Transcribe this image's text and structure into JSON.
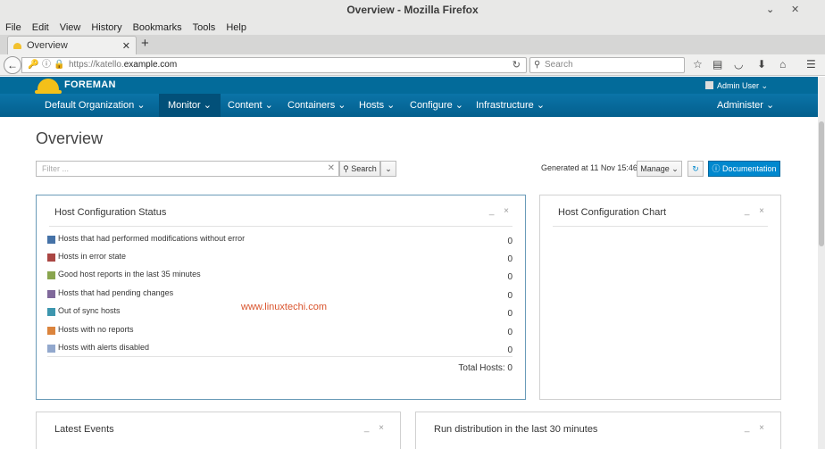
{
  "window": {
    "title": "Overview - Mozilla Firefox",
    "controls": [
      "⌄",
      "✕"
    ]
  },
  "menu": [
    "File",
    "Edit",
    "View",
    "History",
    "Bookmarks",
    "Tools",
    "Help"
  ],
  "tab": {
    "title": "Overview",
    "close": "✕",
    "new_tab": "+"
  },
  "nav": {
    "url_scheme": "https://katello.",
    "url_host": "example.com",
    "search_placeholder": "Search"
  },
  "foreman": {
    "brand": "FOREMAN",
    "user": "Admin User ⌄",
    "nav": {
      "org": "Default Organization ⌄",
      "monitor": "Monitor ⌄",
      "content": "Content ⌄",
      "containers": "Containers ⌄",
      "hosts": "Hosts ⌄",
      "configure": "Configure ⌄",
      "infrastructure": "Infrastructure ⌄",
      "administer": "Administer ⌄"
    }
  },
  "page": {
    "title": "Overview",
    "filter_placeholder": "Filter ...",
    "search_button": "Search",
    "generated": "Generated at 11 Nov 15:46",
    "manage_button": "Manage ⌄",
    "documentation_button": "Documentation"
  },
  "widgets": {
    "host_config_status": {
      "title": "Host Configuration Status",
      "rows": [
        {
          "label": "Hosts that had performed modifications without error",
          "count": "0",
          "color": "#4572a7"
        },
        {
          "label": "Hosts in error state",
          "count": "0",
          "color": "#aa4643"
        },
        {
          "label": "Good host reports in the last 35 minutes",
          "count": "0",
          "color": "#89a54e"
        },
        {
          "label": "Hosts that had pending changes",
          "count": "0",
          "color": "#80699b"
        },
        {
          "label": "Out of sync hosts",
          "count": "0",
          "color": "#3d96ae"
        },
        {
          "label": "Hosts with no reports",
          "count": "0",
          "color": "#db843d"
        },
        {
          "label": "Hosts with alerts disabled",
          "count": "0",
          "color": "#92a8cd"
        }
      ],
      "total": "Total Hosts: 0"
    },
    "host_config_chart": {
      "title": "Host Configuration Chart"
    },
    "latest_events": {
      "title": "Latest Events"
    },
    "run_distribution": {
      "title": "Run distribution in the last 30 minutes"
    },
    "widget_controls": "_ ×"
  },
  "watermark": "www.linuxtechi.com"
}
